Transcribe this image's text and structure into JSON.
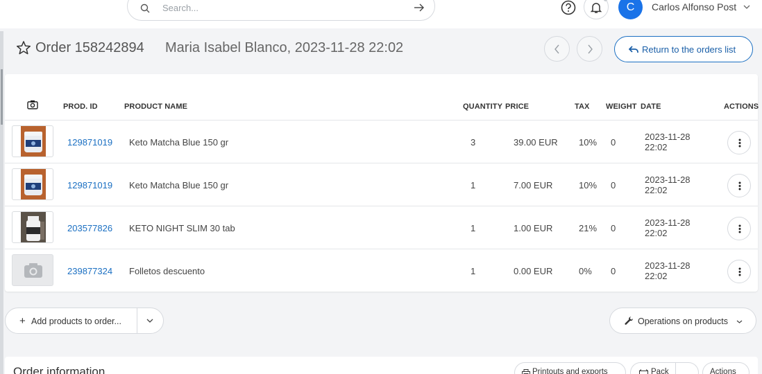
{
  "search": {
    "placeholder": "Search..."
  },
  "user": {
    "avatar_letter": "C",
    "name": "Carlos Alfonso Post"
  },
  "order": {
    "title": "Order 158242894",
    "subtitle": "Maria Isabel Blanco, 2023-11-28 22:02",
    "return_label": "Return to the orders list"
  },
  "table": {
    "headers": {
      "prod_id": "PROD. ID",
      "product_name": "PRODUCT NAME",
      "quantity": "QUANTITY",
      "price": "PRICE",
      "tax": "TAX",
      "weight": "WEIGHT",
      "date": "DATE",
      "actions": "ACTIONS"
    },
    "rows": [
      {
        "prod_id": "129871019",
        "name": "Keto Matcha Blue 150 gr",
        "quantity": "3",
        "price": "39.00 EUR",
        "tax": "10%",
        "weight": "0",
        "date_line1": "2023-11-28",
        "date_line2": "22:02",
        "image": "matcha-jar"
      },
      {
        "prod_id": "129871019",
        "name": "Keto Matcha Blue 150 gr",
        "quantity": "1",
        "price": "7.00 EUR",
        "tax": "10%",
        "weight": "0",
        "date_line1": "2023-11-28",
        "date_line2": "22:02",
        "image": "matcha-jar"
      },
      {
        "prod_id": "203577826",
        "name": "KETO NIGHT SLIM 30 tab",
        "quantity": "1",
        "price": "1.00 EUR",
        "tax": "21%",
        "weight": "0",
        "date_line1": "2023-11-28",
        "date_line2": "22:02",
        "image": "pill-bottle"
      },
      {
        "prod_id": "239877324",
        "name": "Folletos descuento",
        "quantity": "1",
        "price": "0.00 EUR",
        "tax": "0%",
        "weight": "0",
        "date_line1": "2023-11-28",
        "date_line2": "22:02",
        "image": "placeholder"
      }
    ]
  },
  "controls": {
    "add_products_label": "Add products to order...",
    "operations_label": "Operations on products"
  },
  "order_info": {
    "title": "Order information",
    "printouts_label": "Printouts and exports",
    "pack_label": "Pack",
    "actions_label": "Actions"
  },
  "colors": {
    "accent": "#1a73e8",
    "link": "#1a6fc2"
  }
}
